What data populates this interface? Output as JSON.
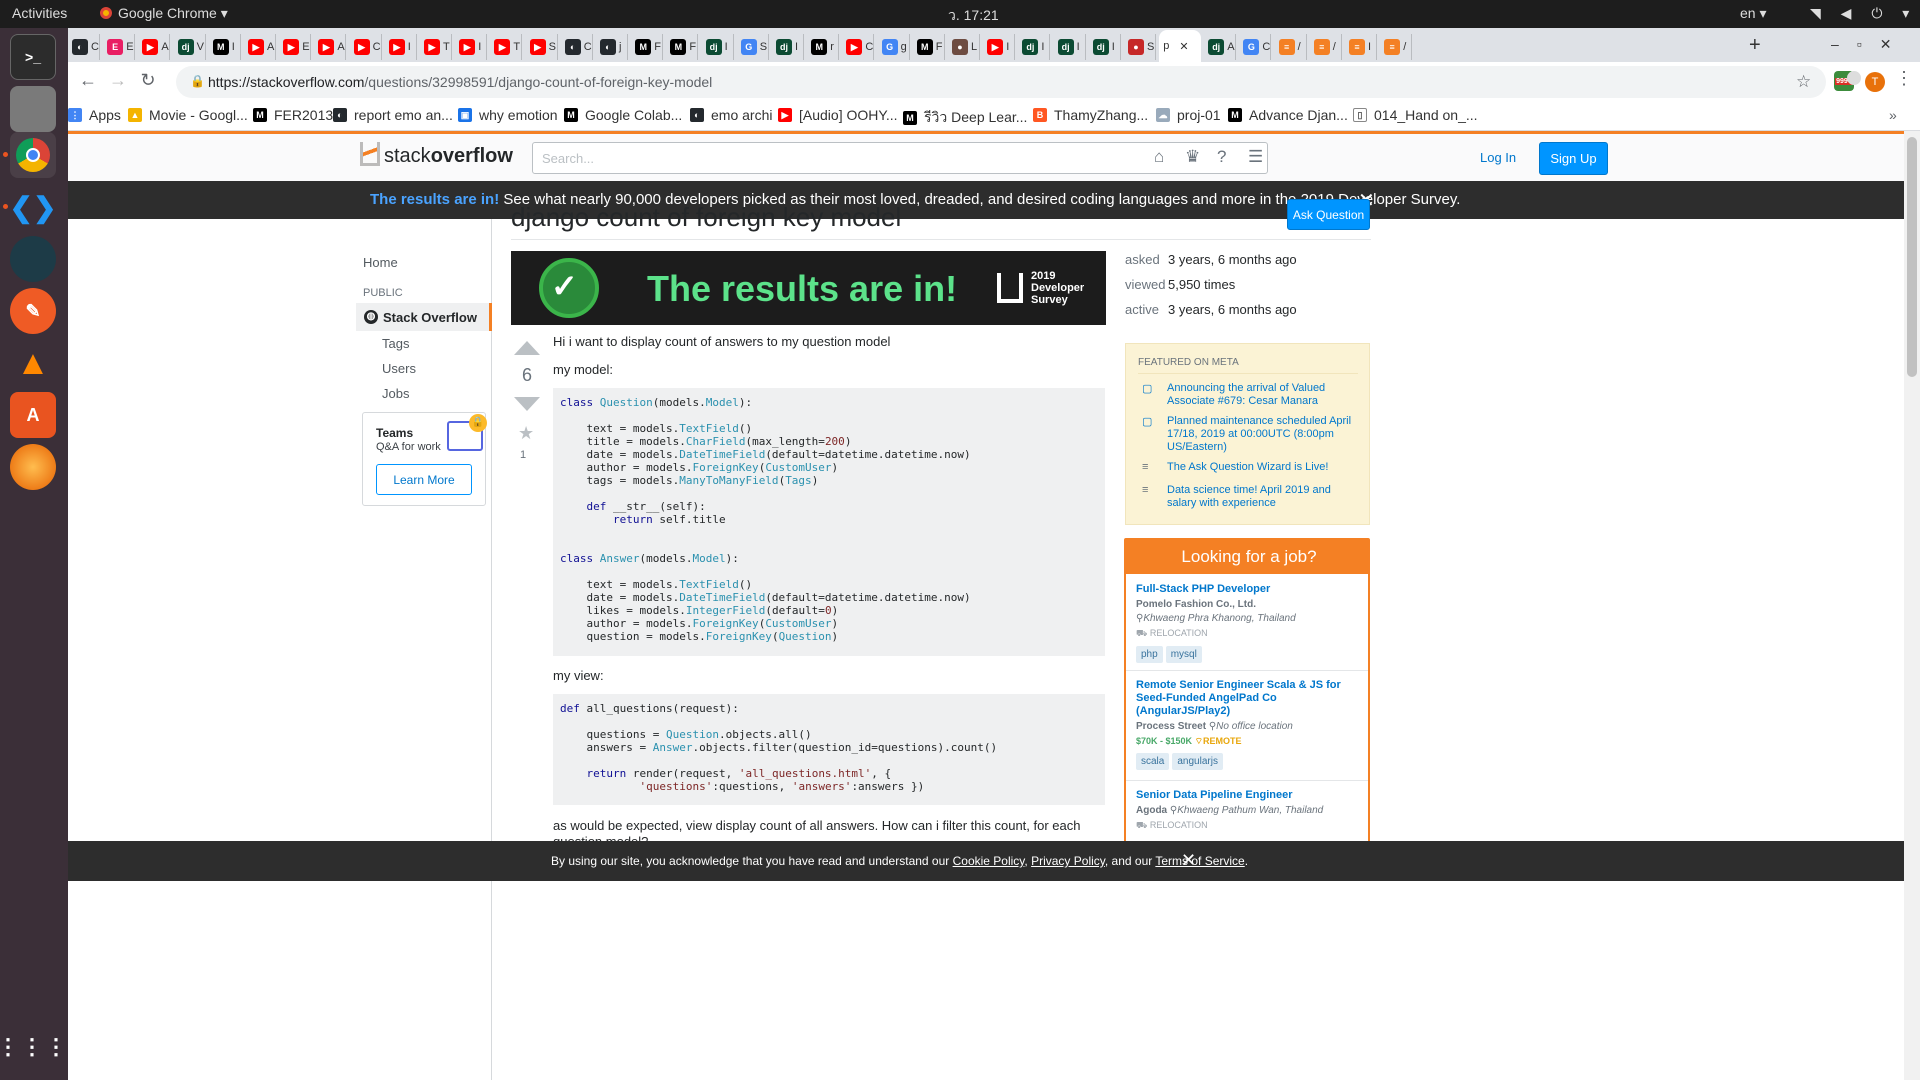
{
  "topbar": {
    "activities": "Activities",
    "app_name": "Google Chrome",
    "clock": "ว. 17:21",
    "lang": "en"
  },
  "browser": {
    "url_host": "https://stackoverflow.com",
    "url_path": "/questions/32998591/django-count-of-foreign-key-model",
    "avatar_letter": "T",
    "ext_badge": "999+",
    "tabs": [
      {
        "fav": "github",
        "label": "C"
      },
      {
        "fav": "ml",
        "label": "E"
      },
      {
        "fav": "youtube",
        "label": "A"
      },
      {
        "fav": "dj",
        "label": "V"
      },
      {
        "fav": "medium",
        "label": "I"
      },
      {
        "fav": "youtube",
        "label": "A"
      },
      {
        "fav": "youtube",
        "label": "E"
      },
      {
        "fav": "youtube",
        "label": "A"
      },
      {
        "fav": "youtube",
        "label": "C"
      },
      {
        "fav": "youtube",
        "label": "I"
      },
      {
        "fav": "youtube",
        "label": "T"
      },
      {
        "fav": "youtube",
        "label": "I"
      },
      {
        "fav": "youtube",
        "label": "T"
      },
      {
        "fav": "youtube",
        "label": "S"
      },
      {
        "fav": "github",
        "label": "C"
      },
      {
        "fav": "github",
        "label": "j"
      },
      {
        "fav": "medium",
        "label": "F"
      },
      {
        "fav": "medium",
        "label": "F"
      },
      {
        "fav": "dj",
        "label": "I"
      },
      {
        "fav": "google",
        "label": "S"
      },
      {
        "fav": "dj",
        "label": "I"
      },
      {
        "fav": "medium",
        "label": "r"
      },
      {
        "fav": "youtube",
        "label": "C"
      },
      {
        "fav": "google",
        "label": "g"
      },
      {
        "fav": "medium",
        "label": "F"
      },
      {
        "fav": "person",
        "label": "L"
      },
      {
        "fav": "youtube",
        "label": "I"
      },
      {
        "fav": "dj",
        "label": "I"
      },
      {
        "fav": "dj",
        "label": "I"
      },
      {
        "fav": "dj",
        "label": "I"
      },
      {
        "fav": "red",
        "label": "S"
      }
    ],
    "active_tab": {
      "label": "p"
    },
    "tabs_after": [
      {
        "fav": "dj",
        "label": "A"
      },
      {
        "fav": "google",
        "label": "C"
      },
      {
        "fav": "so",
        "label": "/"
      },
      {
        "fav": "so",
        "label": "/"
      },
      {
        "fav": "so",
        "label": "I"
      },
      {
        "fav": "so",
        "label": "/"
      }
    ],
    "bookmarks": [
      {
        "icon": "apps",
        "label": "Apps"
      },
      {
        "icon": "drive",
        "label": "Movie - Googl..."
      },
      {
        "icon": "medium",
        "label": "FER2013"
      },
      {
        "icon": "github",
        "label": "report emo an..."
      },
      {
        "icon": "img",
        "label": "why emotion"
      },
      {
        "icon": "medium",
        "label": "Google Colab..."
      },
      {
        "icon": "github",
        "label": "emo archi"
      },
      {
        "icon": "youtube",
        "label": "[Audio] OOHY..."
      },
      {
        "icon": "medium",
        "label": "รีวิว Deep Lear..."
      },
      {
        "icon": "blogger",
        "label": "ThamyZhang..."
      },
      {
        "icon": "cloud",
        "label": "proj-01"
      },
      {
        "icon": "medium",
        "label": "Advance Djan..."
      },
      {
        "icon": "file",
        "label": "014_Hand on_..."
      }
    ]
  },
  "so": {
    "logo_light": "stack",
    "logo_bold": "overflow",
    "search_placeholder": "Search...",
    "login": "Log In",
    "signup": "Sign Up",
    "banner_highlight": "The results are in!",
    "banner_text": " See what nearly 90,000 developers picked as their most loved, dreaded, and desired coding languages and more in the 2019 Developer Survey."
  },
  "nav": {
    "home": "Home",
    "public": "PUBLIC",
    "stack_overflow": "Stack Overflow",
    "tags": "Tags",
    "users": "Users",
    "jobs": "Jobs",
    "teams_title": "Teams",
    "teams_sub": "Q&A for work",
    "learn_more": "Learn More"
  },
  "question": {
    "title": "django count of foreign key model",
    "ask_button": "Ask Question",
    "ad_headline": "The results are in!",
    "ad_survey": "2019 Developer Survey",
    "votes": "6",
    "favorites": "1",
    "p1": "Hi i want to display count of answers to my question model",
    "p2": "my model:",
    "p3": "my view:",
    "p4": "as would be expected, view display count of all answers. How can i filter this count, for each question model?"
  },
  "stats": {
    "asked_label": "asked",
    "asked_val": "3 years, 6 months ago",
    "viewed_label": "viewed",
    "viewed_val": "5,950 times",
    "active_label": "active",
    "active_val": "3 years, 6 months ago"
  },
  "featured": {
    "heading": "FEATURED ON META",
    "items": [
      "Announcing the arrival of Valued Associate #679: Cesar Manara",
      "Planned maintenance scheduled April 17/18, 2019 at 00:00UTC (8:00pm US/Eastern)",
      "The Ask Question Wizard is Live!",
      "Data science time! April 2019 and salary with experience"
    ]
  },
  "jobs": {
    "heading": "Looking for a job?",
    "list": [
      {
        "title": "Full-Stack PHP Developer",
        "company": "Pomelo Fashion Co., Ltd.",
        "location": "Khwaeng Phra Khanong, Thailand",
        "perk": "RELOCATION",
        "salary": "",
        "tags": [
          "php",
          "mysql"
        ]
      },
      {
        "title": "Remote Senior Engineer Scala & JS for Seed-Funded AngelPad Co (AngularJS/Play2)",
        "company": "Process Street",
        "location": "No office location",
        "perk": "REMOTE",
        "salary": "$70K - $150K",
        "tags": [
          "scala",
          "angularjs"
        ]
      },
      {
        "title": "Senior Data Pipeline Engineer",
        "company": "Agoda",
        "location": "Khwaeng Pathum Wan, Thailand",
        "perk": "RELOCATION",
        "salary": "",
        "tags": []
      }
    ]
  },
  "cookie": {
    "prefix": "By using our site, you acknowledge that you have read and understand our ",
    "cookie_policy": "Cookie Policy",
    "sep1": ", ",
    "privacy_policy": "Privacy Policy",
    "sep2": ", and our ",
    "terms": "Terms of Service",
    "suffix": "."
  }
}
